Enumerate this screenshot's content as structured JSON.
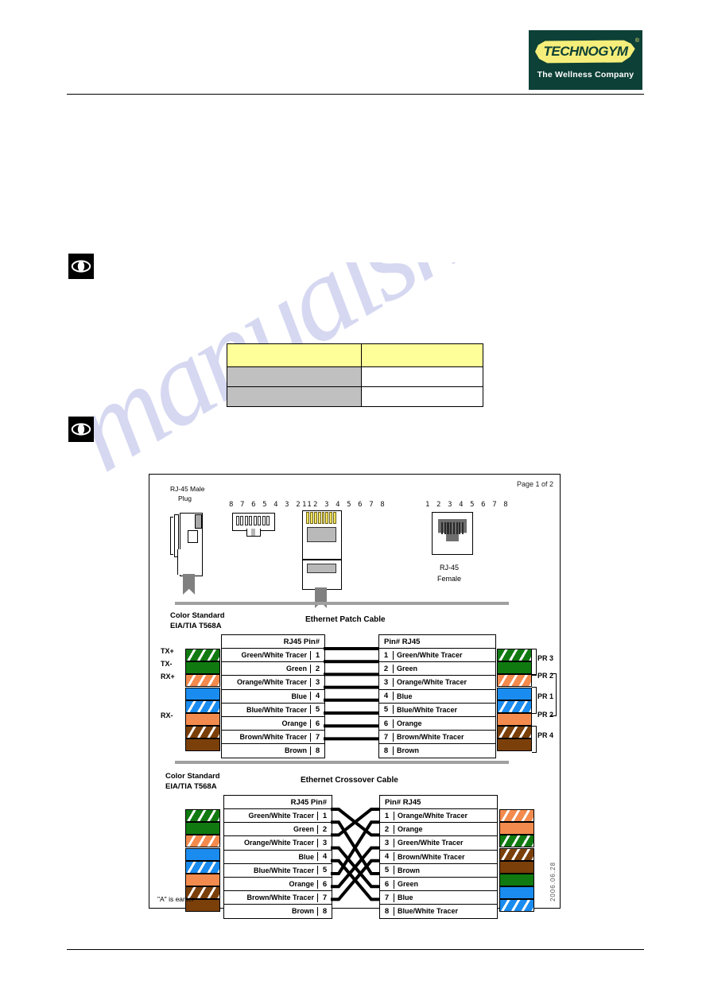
{
  "header": {
    "logo_word": "TECHNOGYM",
    "logo_registered": "®",
    "logo_tagline": "The Wellness Company"
  },
  "notes": [
    {
      "icon": "eye-icon",
      "text": ""
    },
    {
      "icon": "eye-icon",
      "text": ""
    }
  ],
  "info_table": {
    "header": [
      "",
      ""
    ],
    "rows": [
      [
        "",
        ""
      ],
      [
        "",
        ""
      ]
    ],
    "header_color": "#ffff99",
    "label_cell_color": "#c0c0c0"
  },
  "watermark": {
    "text": "manualshive.com",
    "color": "#787dd2"
  },
  "diagram": {
    "page_label": "Page 1 of 2",
    "date_stamp": "2006.06.28",
    "connectors": {
      "male_plug_label_line1": "RJ-45 Male",
      "male_plug_label_line2": "Plug",
      "pin_row_reversed": "8 7 6 5 4 3 2 1",
      "pin_row_forward": "1 2 3 4 5 6 7 8",
      "pin_row_female": "1 2 3 4 5 6 7 8",
      "female_label_line1": "RJ-45",
      "female_label_line2": "Female"
    },
    "patch": {
      "color_standard_line1": "Color  Standard",
      "color_standard_line2": "EIA/TIA T568A",
      "title": "Ethernet Patch Cable",
      "left_header": "RJ45   Pin#",
      "right_header": "Pin#   RJ45",
      "signal_labels": [
        "TX+",
        "TX-",
        "RX+",
        "",
        "",
        "RX-",
        "",
        ""
      ],
      "left_rows": [
        {
          "pin": "1",
          "name": "Green/White Tracer",
          "color": "green",
          "tracer": true
        },
        {
          "pin": "2",
          "name": "Green",
          "color": "green",
          "tracer": false
        },
        {
          "pin": "3",
          "name": "Orange/White Tracer",
          "color": "orange",
          "tracer": true
        },
        {
          "pin": "4",
          "name": "Blue",
          "color": "blue",
          "tracer": false
        },
        {
          "pin": "5",
          "name": "Blue/White Tracer",
          "color": "blue",
          "tracer": true
        },
        {
          "pin": "6",
          "name": "Orange",
          "color": "orange",
          "tracer": false
        },
        {
          "pin": "7",
          "name": "Brown/White Tracer",
          "color": "brown",
          "tracer": true
        },
        {
          "pin": "8",
          "name": "Brown",
          "color": "brown",
          "tracer": false
        }
      ],
      "right_rows": [
        {
          "pin": "1",
          "name": "Green/White Tracer",
          "color": "green",
          "tracer": true
        },
        {
          "pin": "2",
          "name": "Green",
          "color": "green",
          "tracer": false
        },
        {
          "pin": "3",
          "name": "Orange/White Tracer",
          "color": "orange",
          "tracer": true
        },
        {
          "pin": "4",
          "name": "Blue",
          "color": "blue",
          "tracer": false
        },
        {
          "pin": "5",
          "name": "Blue/White Tracer",
          "color": "blue",
          "tracer": true
        },
        {
          "pin": "6",
          "name": "Orange",
          "color": "orange",
          "tracer": false
        },
        {
          "pin": "7",
          "name": "Brown/White Tracer",
          "color": "brown",
          "tracer": true
        },
        {
          "pin": "8",
          "name": "Brown",
          "color": "brown",
          "tracer": false
        }
      ],
      "pair_labels": [
        "PR 3",
        "PR 2",
        "PR 1",
        "PR 2",
        "PR 4"
      ],
      "mapping": [
        [
          1,
          1
        ],
        [
          2,
          2
        ],
        [
          3,
          3
        ],
        [
          4,
          4
        ],
        [
          5,
          5
        ],
        [
          6,
          6
        ],
        [
          7,
          7
        ],
        [
          8,
          8
        ]
      ]
    },
    "crossover": {
      "color_standard_line1": "Color  Standard",
      "color_standard_line2": "EIA/TIA T568A",
      "title": "Ethernet Crossover Cable",
      "left_header": "RJ45   Pin#",
      "right_header": "Pin#   RJ45",
      "left_rows": [
        {
          "pin": "1",
          "name": "Green/White Tracer",
          "color": "green",
          "tracer": true
        },
        {
          "pin": "2",
          "name": "Green",
          "color": "green",
          "tracer": false
        },
        {
          "pin": "3",
          "name": "Orange/White Tracer",
          "color": "orange",
          "tracer": true
        },
        {
          "pin": "4",
          "name": "Blue",
          "color": "blue",
          "tracer": false
        },
        {
          "pin": "5",
          "name": "Blue/White Tracer",
          "color": "blue",
          "tracer": true
        },
        {
          "pin": "6",
          "name": "Orange",
          "color": "orange",
          "tracer": false
        },
        {
          "pin": "7",
          "name": "Brown/White Tracer",
          "color": "brown",
          "tracer": true
        },
        {
          "pin": "8",
          "name": "Brown",
          "color": "brown",
          "tracer": false
        }
      ],
      "right_rows": [
        {
          "pin": "1",
          "name": "Orange/White Tracer",
          "color": "orange",
          "tracer": true
        },
        {
          "pin": "2",
          "name": "Orange",
          "color": "orange",
          "tracer": false
        },
        {
          "pin": "3",
          "name": "Green/White Tracer",
          "color": "green",
          "tracer": true
        },
        {
          "pin": "4",
          "name": "Brown/White Tracer",
          "color": "brown",
          "tracer": true
        },
        {
          "pin": "5",
          "name": "Brown",
          "color": "brown",
          "tracer": false
        },
        {
          "pin": "6",
          "name": "Green",
          "color": "green",
          "tracer": false
        },
        {
          "pin": "7",
          "name": "Blue",
          "color": "blue",
          "tracer": false
        },
        {
          "pin": "8",
          "name": "Blue/White Tracer",
          "color": "blue",
          "tracer": true
        }
      ],
      "mapping": [
        [
          1,
          3
        ],
        [
          2,
          6
        ],
        [
          3,
          1
        ],
        [
          4,
          7
        ],
        [
          5,
          8
        ],
        [
          6,
          2
        ],
        [
          7,
          4
        ],
        [
          8,
          5
        ]
      ],
      "footnote": "\"A\" is earlier"
    }
  },
  "colors": {
    "green": "#107a10",
    "orange": "#f48b4e",
    "blue": "#1a8cf0",
    "brown": "#7b3f0a",
    "logo_bg": "#0d4036",
    "logo_yellow": "#f5ee7a"
  }
}
